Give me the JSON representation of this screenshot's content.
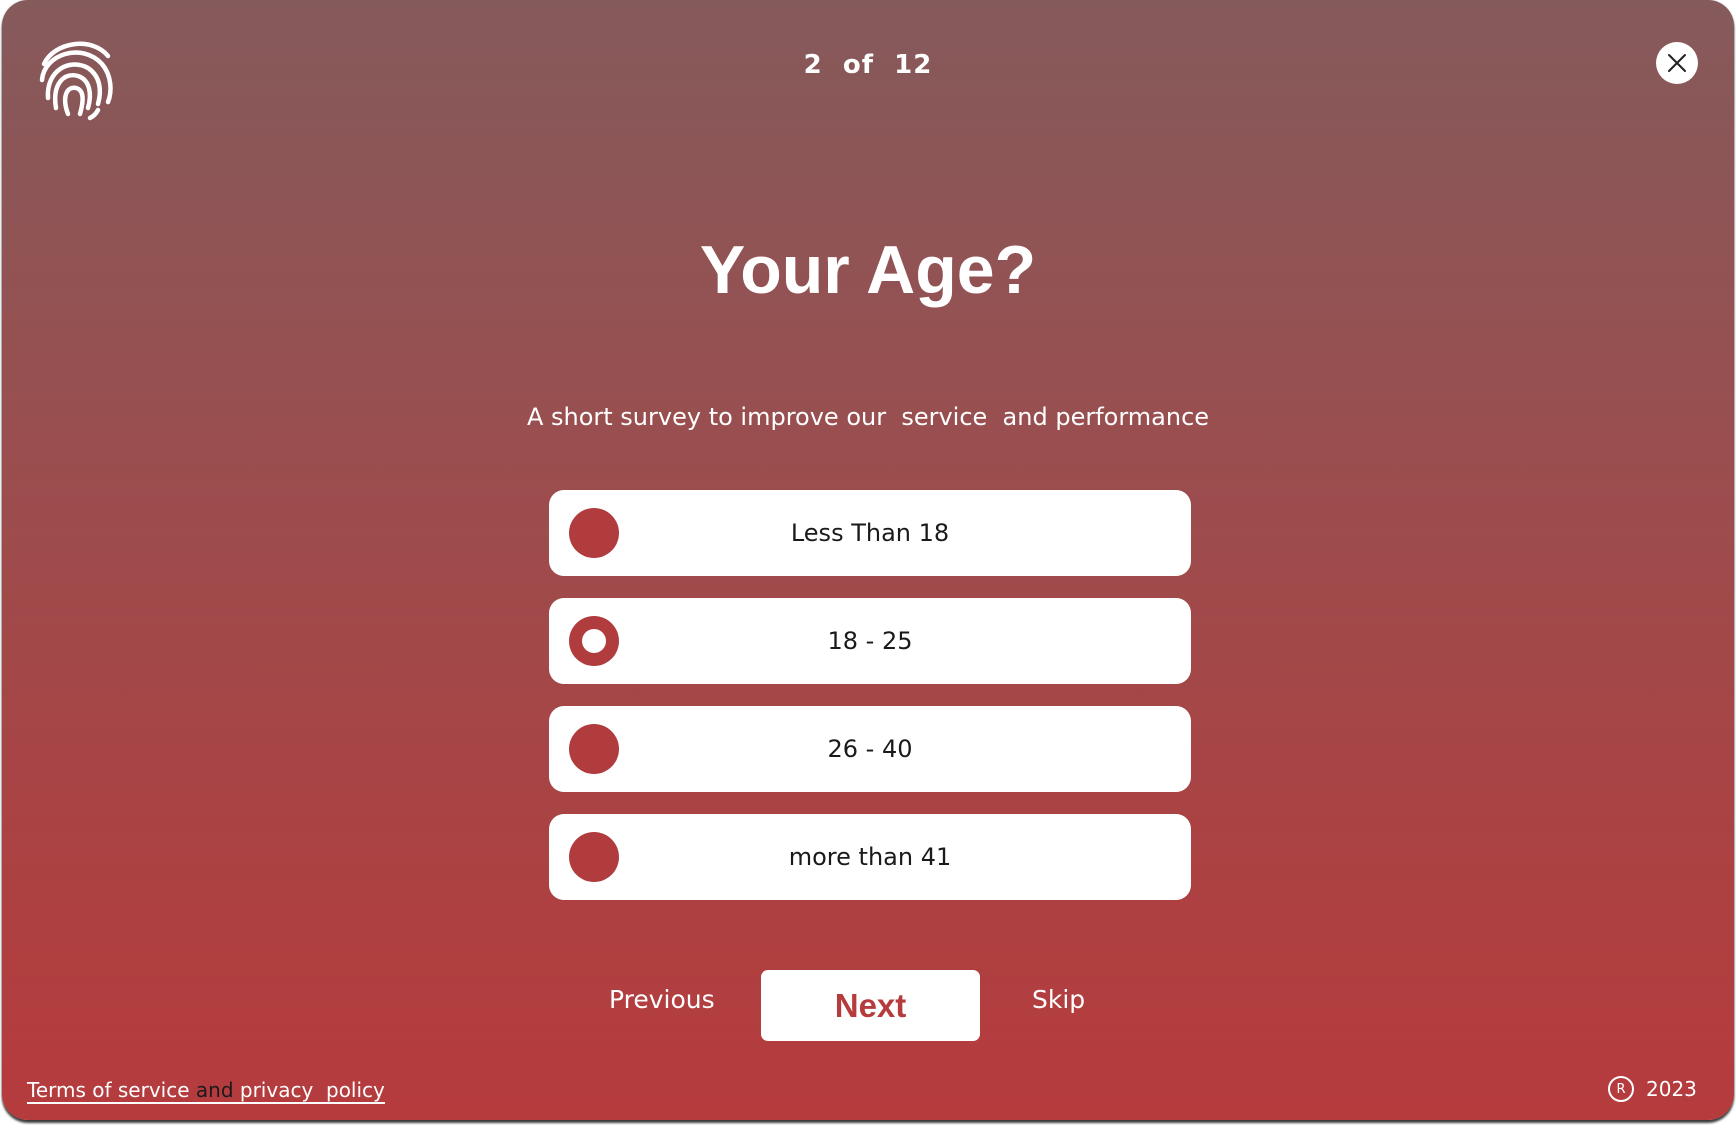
{
  "header": {
    "current_step": "2",
    "of_label": "of",
    "total_steps": "12",
    "logo_icon": "fingerprint-icon",
    "close_icon": "close-icon"
  },
  "question": {
    "title": "Your Age?",
    "subtitle": "A short survey to improve our  service  and performance"
  },
  "options": [
    {
      "label": "Less Than 18",
      "selected": false
    },
    {
      "label": "18 - 25",
      "selected": true
    },
    {
      "label": "26 - 40",
      "selected": false
    },
    {
      "label": "more than 41",
      "selected": false
    }
  ],
  "navigation": {
    "previous_label": "Previous",
    "next_label": "Next",
    "skip_label": "Skip"
  },
  "footer": {
    "terms_label": "Terms of service",
    "and_label": "and",
    "privacy_label": "privacy  policy",
    "copyright_icon": "registered-icon",
    "copyright_symbol": "R",
    "year": "2023"
  },
  "colors": {
    "accent": "#b63b3d",
    "gradient_top": "#855a5b",
    "gradient_bottom": "#b63b3d"
  }
}
